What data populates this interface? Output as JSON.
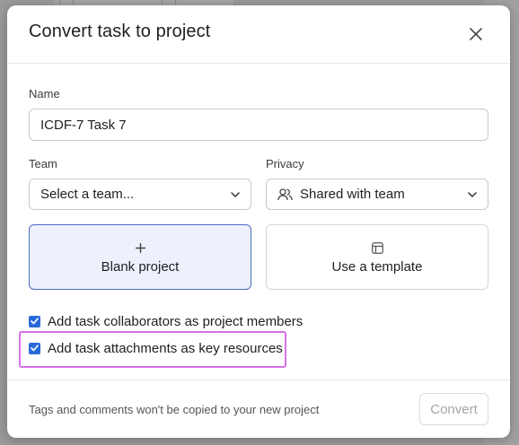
{
  "dialog": {
    "title": "Convert task to project"
  },
  "name_field": {
    "label": "Name",
    "value": "ICDF-7 Task 7"
  },
  "team_field": {
    "label": "Team",
    "selected": "Select a team..."
  },
  "privacy_field": {
    "label": "Privacy",
    "selected": "Shared with team",
    "icon": "people-icon"
  },
  "options": {
    "blank_project": {
      "label": "Blank project",
      "icon": "plus-icon",
      "selected": true
    },
    "use_template": {
      "label": "Use a template",
      "icon": "template-icon",
      "selected": false
    }
  },
  "checkboxes": [
    {
      "label": "Add task collaborators as project members",
      "checked": true
    },
    {
      "label": "Add task attachments as key resources",
      "checked": true
    }
  ],
  "footer": {
    "note": "Tags and comments won't be copied to your new project",
    "convert_label": "Convert"
  },
  "colors": {
    "accent": "#2a6ad8",
    "selected_card_bg": "#eef1fb",
    "selected_card_border": "#4a6bbf",
    "highlight": "#d671e6",
    "disabled_text": "#a6a6a6"
  }
}
